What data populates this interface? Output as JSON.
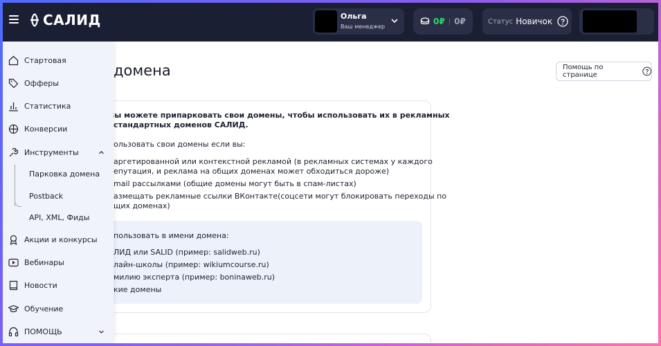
{
  "header": {
    "logo_text": "САЛИД",
    "manager": {
      "name": "Ольга",
      "role": "Ваш менеджер"
    },
    "balance": {
      "main": "0₽",
      "hold": "0₽"
    },
    "status": {
      "label": "Статус",
      "value": "Новичок"
    }
  },
  "sidebar": {
    "items": [
      {
        "label": "Стартовая",
        "icon": "home-icon"
      },
      {
        "label": "Офферы",
        "icon": "tag-icon"
      },
      {
        "label": "Статистика",
        "icon": "bar-chart-icon"
      },
      {
        "label": "Конверсии",
        "icon": "crosshair-icon"
      },
      {
        "label": "Инструменты",
        "icon": "tools-icon"
      },
      {
        "label": "Акции и конкурсы",
        "icon": "award-icon"
      },
      {
        "label": "Вебинары",
        "icon": "play-icon"
      },
      {
        "label": "Новости",
        "icon": "book-icon"
      },
      {
        "label": "Обучение",
        "icon": "graduation-icon"
      },
      {
        "label": "ПОМОЩЬ",
        "icon": "headphones-icon"
      }
    ],
    "sub_items": [
      "Парковка домена",
      "Postback",
      "API, XML, Фиды"
    ]
  },
  "main": {
    "title": "домена",
    "help_button": "Помощь по странице",
    "intro_line1": "Вы можете припарковать свои домены, чтобы использовать их в рекламных",
    "intro_line2": "стандартных доменов САЛИД.",
    "use_heading": "ользовать свои домены если вы:",
    "bullets": [
      "аргетированной или контекстной рекламой (в рекламных системах у каждого",
      "епутация, и реклама на общих доменах может обходиться дороже)",
      "mail рассылками (общие домены могут быть в спам-листах)",
      "азмещать рекламные ссылки ВКонтакте(соцсети могут блокировать переходы по",
      "щих доменах)"
    ],
    "forbid_heading": "пользовать в имени домена:",
    "forbid_items": [
      "ЛИД или SALID (пример: salidweb.ru)",
      "лайн-школы (пример: wikiumcourse.ru)",
      "милию эксперта (пример: boninaweb.ru)",
      "кие домены"
    ]
  },
  "colors": {
    "topbar": "#1b1f33",
    "accent_green": "#2bd66b",
    "sidebar_bg": "#f0f3f9",
    "inner_box": "#edf1fa"
  }
}
